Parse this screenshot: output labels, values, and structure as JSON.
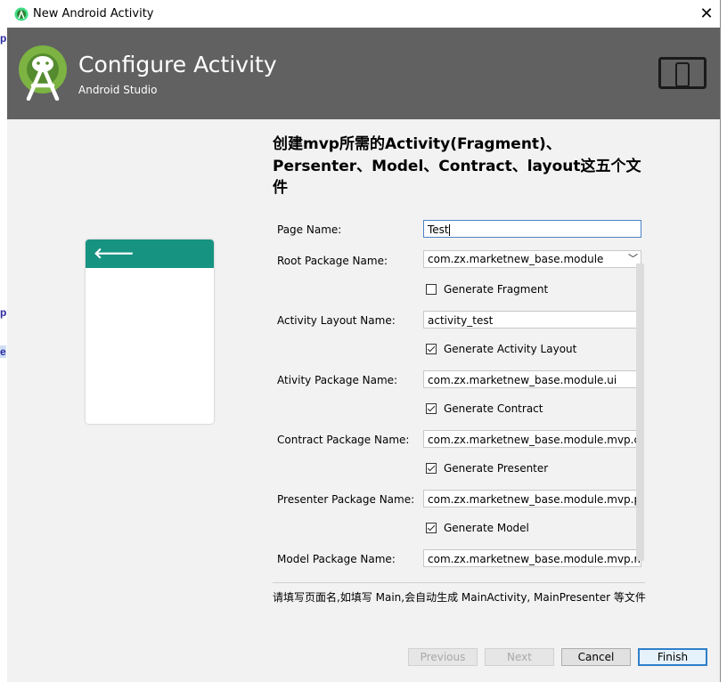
{
  "window": {
    "title": "New Android Activity",
    "close_icon": "close-icon"
  },
  "background_edge": {
    "marks": [
      "p",
      "p",
      "e"
    ]
  },
  "banner": {
    "title": "Configure Activity",
    "subtitle": "Android Studio",
    "logo_icon": "android-studio-logo",
    "device_icon": "phone-tablet-icon",
    "background_color": "#616161"
  },
  "heading": "创建mvp所需的Activity(Fragment)、Persenter、Model、Contract、layout这五个文件",
  "preview": {
    "toolbar_color": "#179382",
    "back_icon": "back-arrow-icon"
  },
  "form": {
    "page_name": {
      "label": "Page Name:",
      "value": "Test"
    },
    "root_package": {
      "label": "Root Package Name:",
      "value": "com.zx.marketnew_base.module"
    },
    "generate_fragment": {
      "label": "Generate Fragment",
      "checked": false
    },
    "activity_layout": {
      "label": "Activity Layout Name:",
      "value": "activity_test"
    },
    "generate_activity_layout": {
      "label": "Generate Activity Layout",
      "checked": true
    },
    "activity_package": {
      "label": "Ativity Package Name:",
      "value": "com.zx.marketnew_base.module.ui"
    },
    "generate_contract": {
      "label": "Generate Contract",
      "checked": true
    },
    "contract_package": {
      "label": "Contract Package Name:",
      "value": "com.zx.marketnew_base.module.mvp.contract"
    },
    "generate_presenter": {
      "label": "Generate Presenter",
      "checked": true
    },
    "presenter_package": {
      "label": "Presenter Package Name:",
      "value": "com.zx.marketnew_base.module.mvp.presenter"
    },
    "generate_model": {
      "label": "Generate Model",
      "checked": true
    },
    "model_package": {
      "label": "Model Package Name:",
      "value": "com.zx.marketnew_base.module.mvp.model"
    }
  },
  "hint": "请填写页面名,如填写 Main,会自动生成 MainActivity, MainPresenter 等文件",
  "buttons": {
    "previous": "Previous",
    "next": "Next",
    "cancel": "Cancel",
    "finish": "Finish"
  }
}
